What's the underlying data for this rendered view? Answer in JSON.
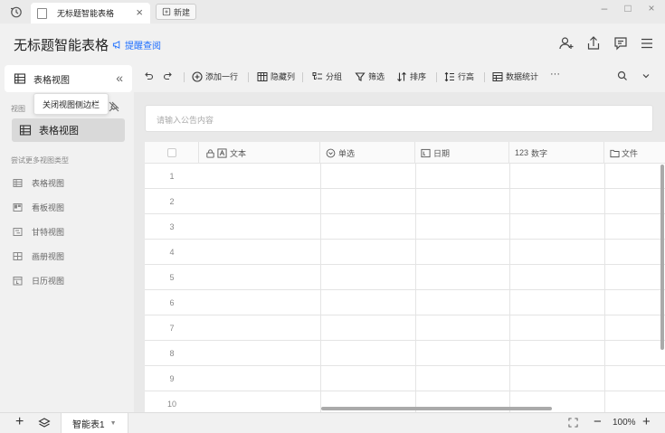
{
  "titlebar": {
    "tab_title": "无标题智能表格",
    "tab_close": "×",
    "new_label": "新建",
    "minimize": "–",
    "maximize": "□",
    "close": "×"
  },
  "header": {
    "doc_title": "无标题智能表格",
    "remind_label": "提醒查阅"
  },
  "sidebar": {
    "current_view": "表格视图",
    "collapse_glyph": "«",
    "tooltip": "关闭视图侧边栏",
    "views_label": "视图",
    "active_view": "表格视图",
    "try_more_label": "尝试更多视图类型",
    "more_views": [
      {
        "label": "表格视图",
        "icon": "grid-icon"
      },
      {
        "label": "看板视图",
        "icon": "kanban-icon"
      },
      {
        "label": "甘特视图",
        "icon": "gantt-icon"
      },
      {
        "label": "画册视图",
        "icon": "gallery-icon"
      },
      {
        "label": "日历视图",
        "icon": "calendar-icon"
      }
    ]
  },
  "toolbar": {
    "add_row": "添加一行",
    "hide_cols": "隐藏列",
    "group": "分组",
    "filter": "筛选",
    "sort": "排序",
    "row_height": "行高",
    "stats": "数据统计",
    "more": "···"
  },
  "notice": {
    "placeholder": "请输入公告内容"
  },
  "grid": {
    "columns": [
      {
        "label": "文本",
        "icon": "text-field-icon"
      },
      {
        "label": "单选",
        "icon": "single-select-icon"
      },
      {
        "label": "日期",
        "icon": "date-field-icon"
      },
      {
        "label": "数字",
        "prefix": "123"
      },
      {
        "label": "文件",
        "icon": "folder-icon"
      }
    ],
    "rows": [
      "1",
      "2",
      "3",
      "4",
      "5",
      "6",
      "7",
      "8",
      "9",
      "10"
    ]
  },
  "bottombar": {
    "sheet_name": "智能表1",
    "sheet_caret": "▼",
    "zoom": "100%",
    "zoom_out": "−",
    "zoom_in": "+",
    "add": "+"
  },
  "colors": {
    "accent": "#1e6fff",
    "background": "#f1f1f1",
    "grid_bg": "#ffffff",
    "active_view_bg": "#d9d9d9"
  }
}
